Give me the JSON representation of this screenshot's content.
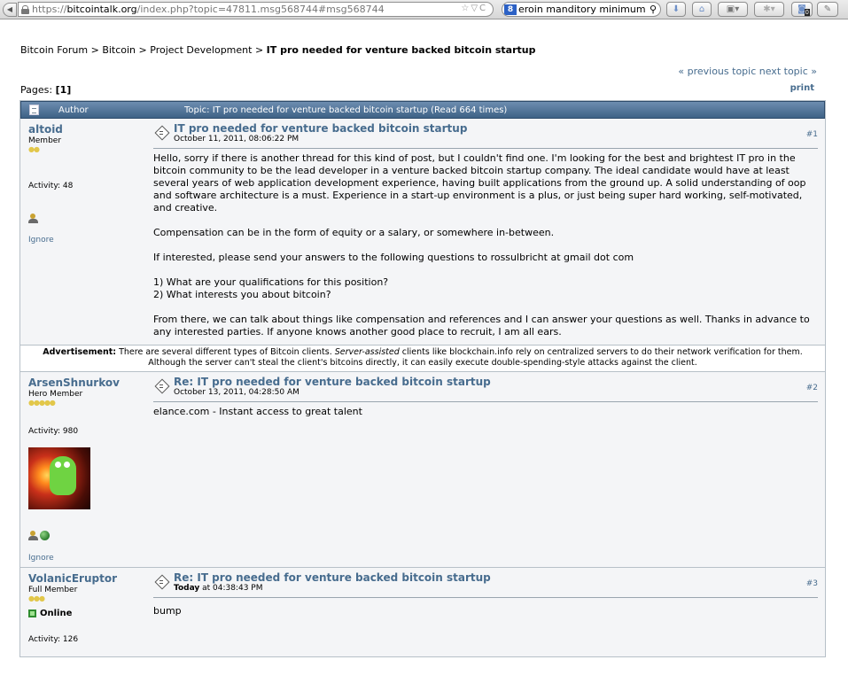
{
  "browser": {
    "url_scheme": "https://",
    "url_host": "bitcointalk.org",
    "url_path": "/index.php?topic=47811.msg568744#msg568744",
    "search_query": "eroin manditory minimum",
    "addon_count": "0"
  },
  "breadcrumb": {
    "items": [
      "Bitcoin Forum",
      "Bitcoin",
      "Project Development"
    ],
    "current": "IT pro needed for venture backed bitcoin startup",
    "separator": ">"
  },
  "topic_nav": {
    "previous": "« previous topic",
    "next": "next topic »"
  },
  "pages": {
    "label": "Pages: ",
    "current": "[1]"
  },
  "print_label": "print",
  "header": {
    "author_label": "Author",
    "topic_label": "Topic: IT pro needed for venture backed bitcoin startup  (Read 664 times)"
  },
  "posts": [
    {
      "author": "altoid",
      "rank": "Member",
      "stars": "●●",
      "activity": "Activity: 48",
      "ignore": "Ignore",
      "subject": "IT pro needed for venture backed bitcoin startup",
      "date": "October 11, 2011, 08:06:22 PM",
      "number": "#1",
      "paragraphs": [
        "Hello, sorry if there is another thread for this kind of post, but I couldn't find one.  I'm looking for the best and brightest IT pro in the bitcoin community to be the lead developer in a venture backed bitcoin startup company.  The ideal candidate would have at least several years of web application development experience, having built applications from the ground up.  A solid understanding of oop and software architecture is a must.  Experience in a start-up environment is a plus, or just being super hard working, self-motivated, and creative.",
        "Compensation can be in the form of equity or a salary, or somewhere in-between.",
        "If interested, please send your answers to the following questions to rossulbricht at gmail dot com",
        "1) What are your qualifications for this position?",
        "2) What interests you about bitcoin?",
        "From there, we can talk about things like compensation and references and I can answer your questions as well.  Thanks in advance to any interested parties.  If anyone knows another good place to recruit, I am all ears."
      ]
    },
    {
      "author": "ArsenShnurkov",
      "rank": "Hero Member",
      "stars": "●●●●●",
      "activity": "Activity: 980",
      "ignore": "Ignore",
      "subject": "Re: IT pro needed for venture backed bitcoin startup",
      "date": "October 13, 2011, 04:28:50 AM",
      "number": "#2",
      "body": "elance.com - Instant access to great talent"
    },
    {
      "author": "VolanicEruptor",
      "rank": "Full Member",
      "stars": "●●●",
      "online": "Online",
      "activity": "Activity: 126",
      "subject": "Re: IT pro needed for venture backed bitcoin startup",
      "date_bold": "Today",
      "date_rest": " at 04:38:43 PM",
      "number": "#3",
      "body": "bump"
    }
  ],
  "advertisement": {
    "label": "Advertisement:",
    "text_1": " There are several different types of Bitcoin clients. ",
    "text_italic": "Server-assisted",
    "text_2": " clients like blockchain.info rely on centralized servers to do their network verification for them. Although the server can't steal the client's bitcoins directly, it can easily execute double-spending-style attacks against the client."
  }
}
